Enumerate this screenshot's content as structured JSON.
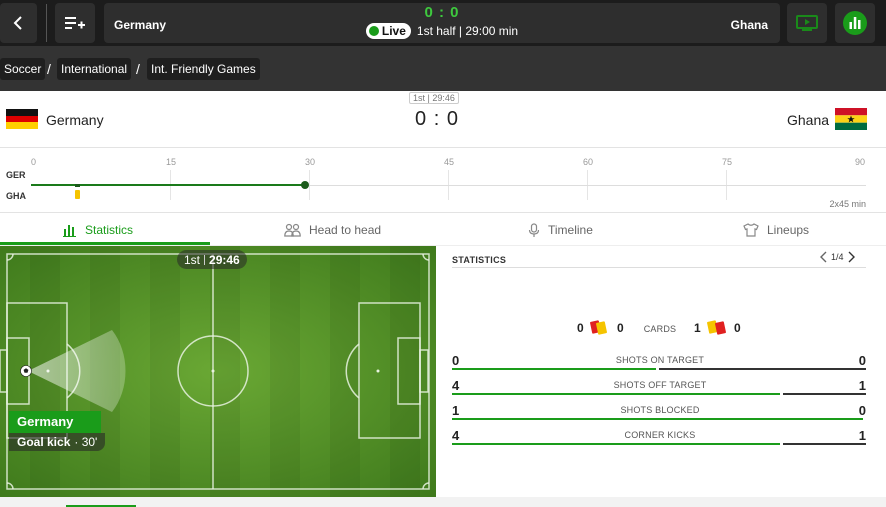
{
  "topbar": {
    "home_team": "Germany",
    "away_team": "Ghana",
    "score": "0 : 0",
    "live_label": "Live",
    "status": "1st half | 29:00 min",
    "icons": {
      "back": "chevron-left-icon",
      "playlist": "playlist-add-icon",
      "video": "tv-icon",
      "stats": "bar-chart-icon"
    }
  },
  "breadcrumb": [
    "Soccer",
    "International",
    "Int. Friendly Games"
  ],
  "match": {
    "home": "Germany",
    "away": "Ghana",
    "clock": "1st | 29:46",
    "score": "0 : 0"
  },
  "timeline": {
    "ticks": [
      "0",
      "15",
      "30",
      "45",
      "60",
      "75",
      "90"
    ],
    "home_code": "GER",
    "away_code": "GHA",
    "duration": "2x45 min",
    "current_minute": 29.77,
    "away_card_minute": 5
  },
  "tabs": [
    "Statistics",
    "Head to head",
    "Timeline",
    "Lineups"
  ],
  "pitch": {
    "period": "1st",
    "time": "29:46",
    "team": "Germany",
    "event": "Goal kick",
    "event_minute": "· 30'"
  },
  "stats": {
    "title": "STATISTICS",
    "page": "1/4",
    "cards": {
      "label": "CARDS",
      "home_yellow": "0",
      "home_red": "0",
      "away_yellow": "1",
      "away_red": "0"
    },
    "rows": [
      {
        "label": "SHOTS ON TARGET",
        "home": "0",
        "away": "0",
        "home_share": 0.5
      },
      {
        "label": "SHOTS OFF TARGET",
        "home": "4",
        "away": "1",
        "home_share": 0.8
      },
      {
        "label": "SHOTS BLOCKED",
        "home": "1",
        "away": "0",
        "home_share": 1.0
      },
      {
        "label": "CORNER KICKS",
        "home": "4",
        "away": "1",
        "home_share": 0.8
      }
    ]
  },
  "colors": {
    "accent": "#1a9c1a",
    "live_score": "#3ec93e",
    "yellow": "#f5c400",
    "red": "#e02020",
    "pitch": "#5a9a2a"
  }
}
